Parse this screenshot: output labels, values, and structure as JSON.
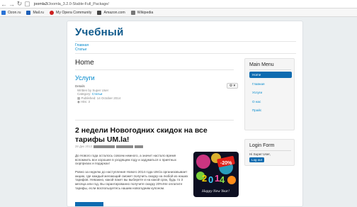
{
  "browser": {
    "url_host": "joomla3",
    "url_path": "/Joomla_3.2.0-Stable-Full_Package/",
    "bookmarks": [
      {
        "label": "Ozon.ru",
        "color": "#2a73d6"
      },
      {
        "label": "Mail.ru",
        "color": "#1d5fb7"
      },
      {
        "label": "My Opera Community",
        "color": "#cc1f1f"
      },
      {
        "label": "Amazon.com",
        "color": "#444444"
      },
      {
        "label": "Wikipedia",
        "color": "#777777"
      }
    ]
  },
  "site": {
    "title": "Учебный",
    "nav": [
      "Главная",
      "Статьи"
    ]
  },
  "main": {
    "heading": "Home",
    "article": {
      "title": "Услуги",
      "details_label": "Details",
      "written_by": "Written by Super User",
      "category_prefix": "Category:",
      "category": "Статьи",
      "published": "Published: 14 October 2014",
      "hits": "Hits: 3"
    },
    "news": {
      "headline": "2 недели Новогодних скидок на все тарифы UM.la!",
      "date": "28 Дек 2013",
      "paragraph1": "До Нового года осталось совсем немного, а значит настало время вспомнить все хорошее в уходящем году и задуматься о приятных сюрпризах и подарках!",
      "paragraph2": "Ровно за неделю до наступления Нового 2014 года UM.la организовывает акцию, где каждый желающий сможет получить скидку на любой из наших тарифов. Неважно, какой пакет вы выберете и на какой срок, будь то 3 месяца или год. Вы гарантированно получите скидку 20%!Не оплатите тарифы, если воспользуетесь нашим новогодним купоном."
    }
  },
  "sidebar": {
    "menu_title": "Main Menu",
    "menu_items": [
      "Home",
      "Главная",
      "Услуги",
      "О нас",
      "Прайс"
    ],
    "login_title": "Login Form",
    "hi_text": "Hi Super User,",
    "logout_label": "Log out"
  },
  "colors": {
    "accent": "#0e6bb0",
    "title": "#0f5a8c",
    "link": "#0088cc"
  }
}
